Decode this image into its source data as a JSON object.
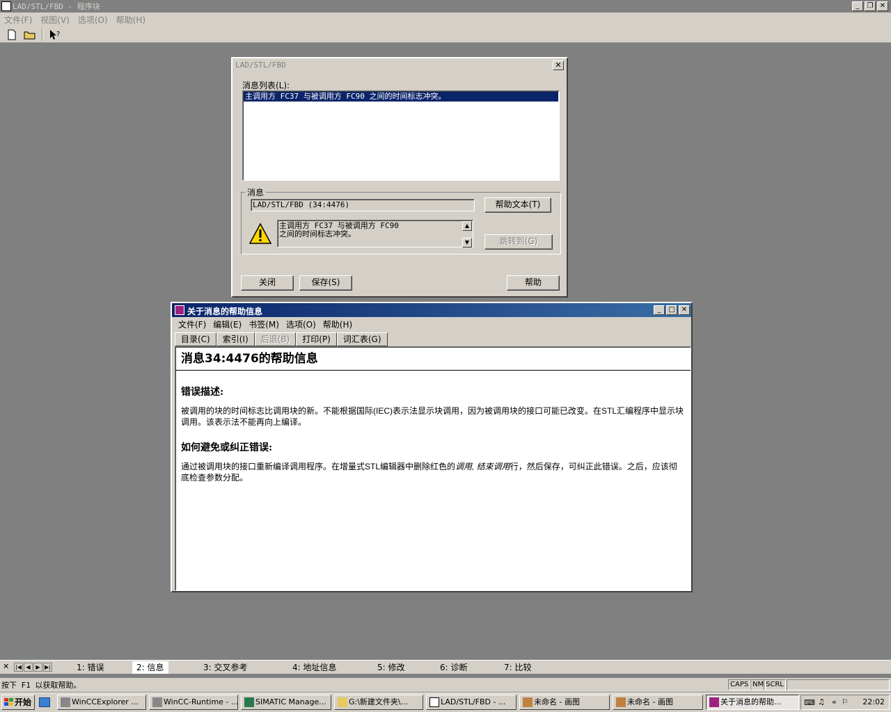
{
  "app": {
    "title": "LAD/STL/FBD  - 程序块",
    "menu": [
      "文件(F)",
      "视图(V)",
      "选项(O)",
      "帮助(H)"
    ],
    "caption_buttons": [
      "_",
      "❐",
      "✕"
    ]
  },
  "lad_dialog": {
    "title": "LAD/STL/FBD",
    "close_label": "✕",
    "list_label": "消息列表(L):",
    "list_items": [
      "主调用方 FC37 与被调用方 FC90 之间的时间标志冲突。"
    ],
    "group_label": "消息",
    "source": "LAD/STL/FBD   (34:4476)",
    "message_line1": "主调用方 FC37 与被调用方 FC90",
    "message_line2": "之间的时间标志冲突。",
    "help_text_button": "帮助文本(T)",
    "goto_button": "跳转到(G)",
    "close_button": "关闭",
    "save_button": "保存(S)",
    "help_button": "帮助"
  },
  "help_window": {
    "title": "关于消息的帮助信息",
    "menu": [
      "文件(F)",
      "编辑(E)",
      "书签(M)",
      "选项(O)",
      "帮助(H)"
    ],
    "buttons": [
      "目录(C)",
      "索引(I)",
      "后退(B)",
      "打印(P)",
      "词汇表(G)"
    ],
    "heading": "消息34:4476的帮助信息",
    "section1_title": "错误描述:",
    "section1_text": "被调用的块的时间标志比调用块的新。不能根据国际(IEC)表示法显示块调用，因为被调用块的接口可能已改变。在STL汇编程序中显示块调用。该表示法不能再向上编译。",
    "section2_title": "如何避免或纠正错误:",
    "section2_text_a": "通过被调用块的接口重新编译调用程序。在增量式STL编辑器中删除红色的",
    "section2_text_italic": "调用, 结束调用",
    "section2_text_b": "行，然后保存，可纠正此错误。之后，应该彻底检查参数分配。"
  },
  "tabs": {
    "close": "✕",
    "items": [
      "1: 错误",
      "2: 信息",
      "3: 交叉参考",
      "4: 地址信息",
      "5: 修改",
      "6: 诊断",
      "7: 比较"
    ],
    "active_index": 1
  },
  "status": {
    "text": "按下 F1 以获取帮助。",
    "indicators": [
      "CAPS",
      "NM",
      "SCRL"
    ]
  },
  "taskbar": {
    "start": "开始",
    "tasks": [
      "WinCCExplorer ...",
      "WinCC-Runtime - ...",
      "SIMATIC Manage...",
      "G:\\新建文件夹\\...",
      "LAD/STL/FBD  - ...",
      "未命名 - 画图",
      "未命名 - 画图",
      "关于消息的帮助..."
    ],
    "active_task_index": 7,
    "clock": "22:02"
  },
  "colors": {
    "selection": "#0a246a",
    "face": "#d4d0c8",
    "desktop": "#808080"
  }
}
